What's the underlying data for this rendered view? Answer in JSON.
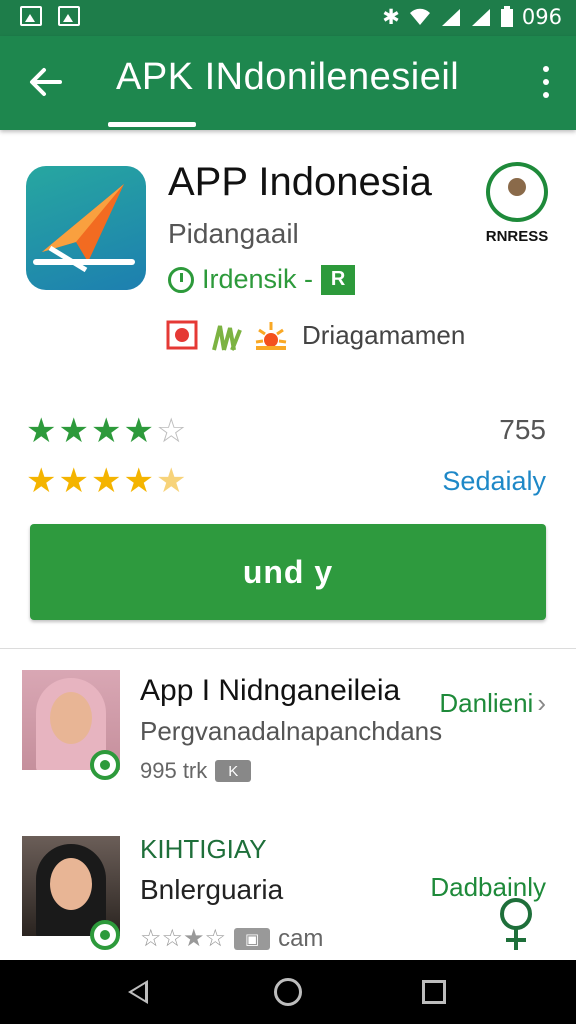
{
  "status_bar": {
    "time": "096",
    "icons": [
      "image-icon",
      "photo-icon",
      "bluetooth-icon",
      "wifi-icon",
      "signal-icon",
      "signal-icon",
      "battery-icon"
    ]
  },
  "app_bar": {
    "title": "APK INdonilenesieil",
    "colors": {
      "primary": "#1e874e",
      "status": "#1e7d4a"
    }
  },
  "app": {
    "name": "APP Indonesia",
    "developer": "Pidangaail",
    "category": "Irdensik -",
    "category_badge": "R",
    "badge_label": "RNRESS",
    "tags_text": "Driagamamen"
  },
  "ratings": {
    "green_stars": 4,
    "yellow_stars": 4.5,
    "count": "755",
    "link": "Sedaialy"
  },
  "install_button": {
    "label": "und y",
    "color": "#2e9a3e"
  },
  "list": [
    {
      "title": "App I Nidnganeileia",
      "subtitle": "Pergvanadalnapanchdans",
      "meta": "995 trk",
      "meta_badge": "K",
      "action": "Danlieni"
    },
    {
      "title": "KIHTIGIAY",
      "subtitle": "Bnlerguaria",
      "meta": "cam",
      "action": "Dadbainly"
    }
  ]
}
